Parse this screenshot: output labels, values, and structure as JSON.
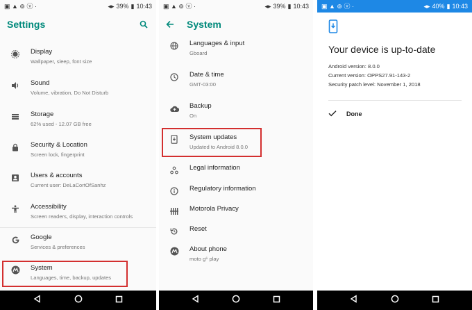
{
  "status_left": {
    "p1": "▣ ▲ ⊚ ⓥ ·",
    "p2": "▣ ▲ ⊚ ⓥ ·",
    "p3": "▣ ▲ ⊚ ⓥ ·"
  },
  "status_right": {
    "p1": {
      "battery": "39%",
      "time": "10:43"
    },
    "p2": {
      "battery": "39%",
      "time": "10:43"
    },
    "p3": {
      "battery": "40%",
      "time": "10:43"
    }
  },
  "settings": {
    "title": "Settings",
    "items": [
      {
        "title": "Display",
        "subtitle": "Wallpaper, sleep, font size",
        "icon": "brightness-icon"
      },
      {
        "title": "Sound",
        "subtitle": "Volume, vibration, Do Not Disturb",
        "icon": "volume-icon"
      },
      {
        "title": "Storage",
        "subtitle": "62% used - 12.07 GB free",
        "icon": "storage-icon"
      },
      {
        "title": "Security & Location",
        "subtitle": "Screen lock, fingerprint",
        "icon": "lock-icon"
      },
      {
        "title": "Users & accounts",
        "subtitle": "Current user: DeLaCortOfSanhz",
        "icon": "account-icon"
      },
      {
        "title": "Accessibility",
        "subtitle": "Screen readers, display, interaction controls",
        "icon": "accessibility-icon"
      },
      {
        "title": "Google",
        "subtitle": "Services & preferences",
        "icon": "google-icon"
      },
      {
        "title": "System",
        "subtitle": "Languages, time, backup, updates",
        "icon": "motorola-icon"
      }
    ]
  },
  "system": {
    "title": "System",
    "items": [
      {
        "title": "Languages & input",
        "subtitle": "Gboard",
        "icon": "globe-icon"
      },
      {
        "title": "Date & time",
        "subtitle": "GMT-03:00",
        "icon": "clock-icon"
      },
      {
        "title": "Backup",
        "subtitle": "On",
        "icon": "cloud-upload-icon"
      },
      {
        "title": "System updates",
        "subtitle": "Updated to Android 8.0.0",
        "icon": "system-update-icon"
      },
      {
        "title": "Legal information",
        "subtitle": "",
        "icon": "legal-icon"
      },
      {
        "title": "Regulatory information",
        "subtitle": "",
        "icon": "info-icon"
      },
      {
        "title": "Motorola Privacy",
        "subtitle": "",
        "icon": "privacy-icon"
      },
      {
        "title": "Reset",
        "subtitle": "",
        "icon": "reset-icon"
      },
      {
        "title": "About phone",
        "subtitle": "moto g⁶ play",
        "icon": "motorola-icon"
      }
    ]
  },
  "update": {
    "title": "Your device is up-to-date",
    "android_version": "Android version: 8.0.0",
    "current_version": "Current version: OPPS27.91-143-2",
    "security_patch": "Security patch level: November 1, 2018",
    "done_label": "Done"
  },
  "colors": {
    "accent": "#00897b",
    "highlight": "#d32f2f",
    "update_statusbar": "#1e88e5",
    "navbar": "#000000"
  }
}
